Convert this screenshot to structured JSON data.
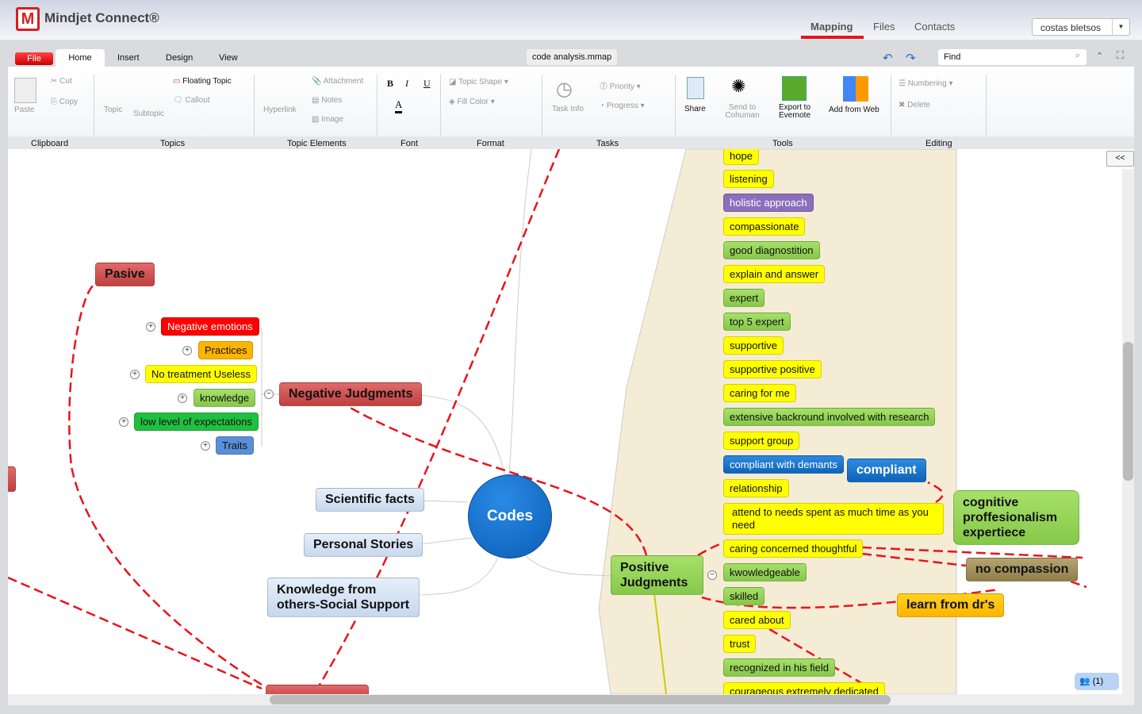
{
  "app": {
    "logo_letter": "M",
    "name": "Mindjet Connect®",
    "nav": [
      "Mapping",
      "Files",
      "Contacts"
    ],
    "active_nav": "Mapping",
    "user": "costas bletsos",
    "accent": "#e8141b"
  },
  "ribbon": {
    "tabs": [
      "File",
      "Home",
      "Insert",
      "Design",
      "View"
    ],
    "active_tab": "Home",
    "document": "code analysis.mmap",
    "find_placeholder": "Find",
    "items": {
      "paste": "Paste",
      "cut": "Cut",
      "copy": "Copy",
      "topic": "Topic",
      "subtopic": "Subtopic",
      "floating": "Floating Topic",
      "callout": "Callout",
      "hyperlink": "Hyperlink",
      "attachment": "Attachment",
      "notes": "Notes",
      "image": "Image",
      "bold": "B",
      "italic": "I",
      "underline": "U",
      "fontcolor": "A",
      "shape": "Topic Shape",
      "fill": "Fill Color",
      "taskinfo": "Task Info",
      "priority": "Priority",
      "progress": "Progress",
      "share": "Share",
      "cohuman": "Send to Cohuman",
      "evernote": "Export to Evernote",
      "addweb": "Add from Web",
      "numbering": "Numbering",
      "delete": "Delete"
    },
    "groups": [
      "Clipboard",
      "Topics",
      "Topic Elements",
      "Font",
      "Format",
      "Tasks",
      "Tools",
      "Editing"
    ]
  },
  "map": {
    "central": "Codes",
    "pasive": "Pasive",
    "negative": "Negative Judgments",
    "negative_children": [
      "Negative emotions",
      "Practices",
      "No treatment Useless",
      "knowledge",
      "low level of expectations",
      "Traits"
    ],
    "left_topics": [
      "Scientific facts",
      "Personal Stories",
      "Knowledge from others-Social Support"
    ],
    "positive": "Positive Judgments",
    "positive_children": [
      "hope",
      "listening",
      "holistic approach",
      "compassionate",
      "good diagnostition",
      "explain and answer",
      "expert",
      "top 5 expert",
      "supportive",
      "supportive positive",
      "caring for me",
      "extensive backround involved with research",
      "support group",
      "compliant with demants",
      "relationship",
      "attend to needs spent as much time as you need",
      "caring concerned thoughtful",
      "kwowledgeable",
      "skilled",
      "cared about",
      "trust",
      "recognized in his field",
      "courageous extremely dedicated"
    ],
    "floating": [
      "compliant",
      "cognitive proffesionalism expertiece",
      "no compassion",
      "learn from dr's"
    ],
    "collapse_label": "<<",
    "users_online": "(1)"
  }
}
